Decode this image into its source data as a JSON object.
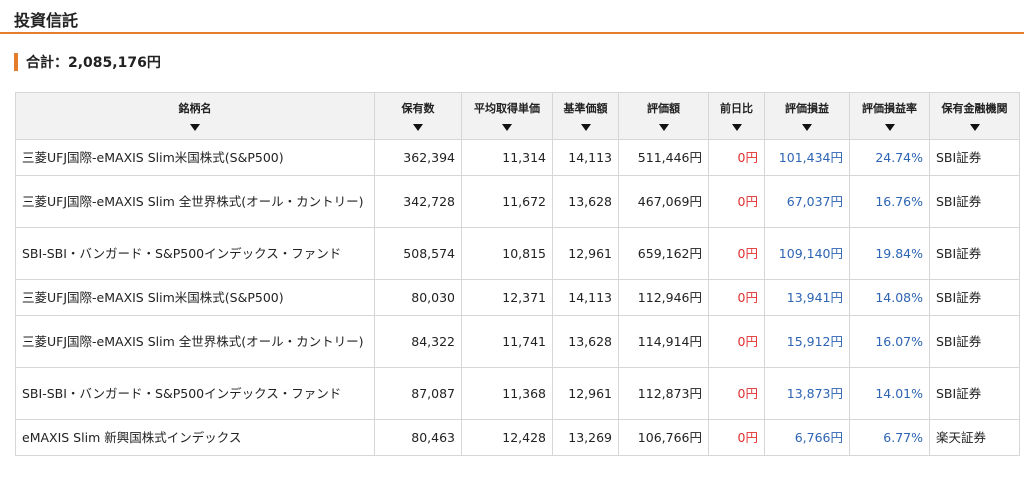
{
  "section_title": "投資信託",
  "total": {
    "label": "合計：",
    "value": "2,085,176円"
  },
  "colors": {
    "accent": "#e57e2c",
    "positive": "#2d64b3",
    "zero_change": "#e0302f"
  },
  "sort_icon": "triangle-down-icon",
  "columns": [
    "銘柄名",
    "保有数",
    "平均取得単価",
    "基準価額",
    "評価額",
    "前日比",
    "評価損益",
    "評価損益率",
    "保有金融機関"
  ],
  "rows": [
    {
      "name": "三菱UFJ国際-eMAXIS Slim米国株式(S&P500)",
      "quantity": "362,394",
      "avg_cost": "11,314",
      "base_price": "14,113",
      "valuation": "511,446円",
      "day_change": "0円",
      "gain": "101,434円",
      "gain_rate": "24.74%",
      "institution": "SBI証券"
    },
    {
      "name": "三菱UFJ国際-eMAXIS Slim 全世界株式(オール・カントリー)",
      "quantity": "342,728",
      "avg_cost": "11,672",
      "base_price": "13,628",
      "valuation": "467,069円",
      "day_change": "0円",
      "gain": "67,037円",
      "gain_rate": "16.76%",
      "institution": "SBI証券"
    },
    {
      "name": "SBI-SBI・バンガード・S&P500インデックス・ファンド",
      "quantity": "508,574",
      "avg_cost": "10,815",
      "base_price": "12,961",
      "valuation": "659,162円",
      "day_change": "0円",
      "gain": "109,140円",
      "gain_rate": "19.84%",
      "institution": "SBI証券"
    },
    {
      "name": "三菱UFJ国際-eMAXIS Slim米国株式(S&P500)",
      "quantity": "80,030",
      "avg_cost": "12,371",
      "base_price": "14,113",
      "valuation": "112,946円",
      "day_change": "0円",
      "gain": "13,941円",
      "gain_rate": "14.08%",
      "institution": "SBI証券"
    },
    {
      "name": "三菱UFJ国際-eMAXIS Slim 全世界株式(オール・カントリー)",
      "quantity": "84,322",
      "avg_cost": "11,741",
      "base_price": "13,628",
      "valuation": "114,914円",
      "day_change": "0円",
      "gain": "15,912円",
      "gain_rate": "16.07%",
      "institution": "SBI証券"
    },
    {
      "name": "SBI-SBI・バンガード・S&P500インデックス・ファンド",
      "quantity": "87,087",
      "avg_cost": "11,368",
      "base_price": "12,961",
      "valuation": "112,873円",
      "day_change": "0円",
      "gain": "13,873円",
      "gain_rate": "14.01%",
      "institution": "SBI証券"
    },
    {
      "name": "eMAXIS Slim 新興国株式インデックス",
      "quantity": "80,463",
      "avg_cost": "12,428",
      "base_price": "13,269",
      "valuation": "106,766円",
      "day_change": "0円",
      "gain": "6,766円",
      "gain_rate": "6.77%",
      "institution": "楽天証券"
    }
  ]
}
